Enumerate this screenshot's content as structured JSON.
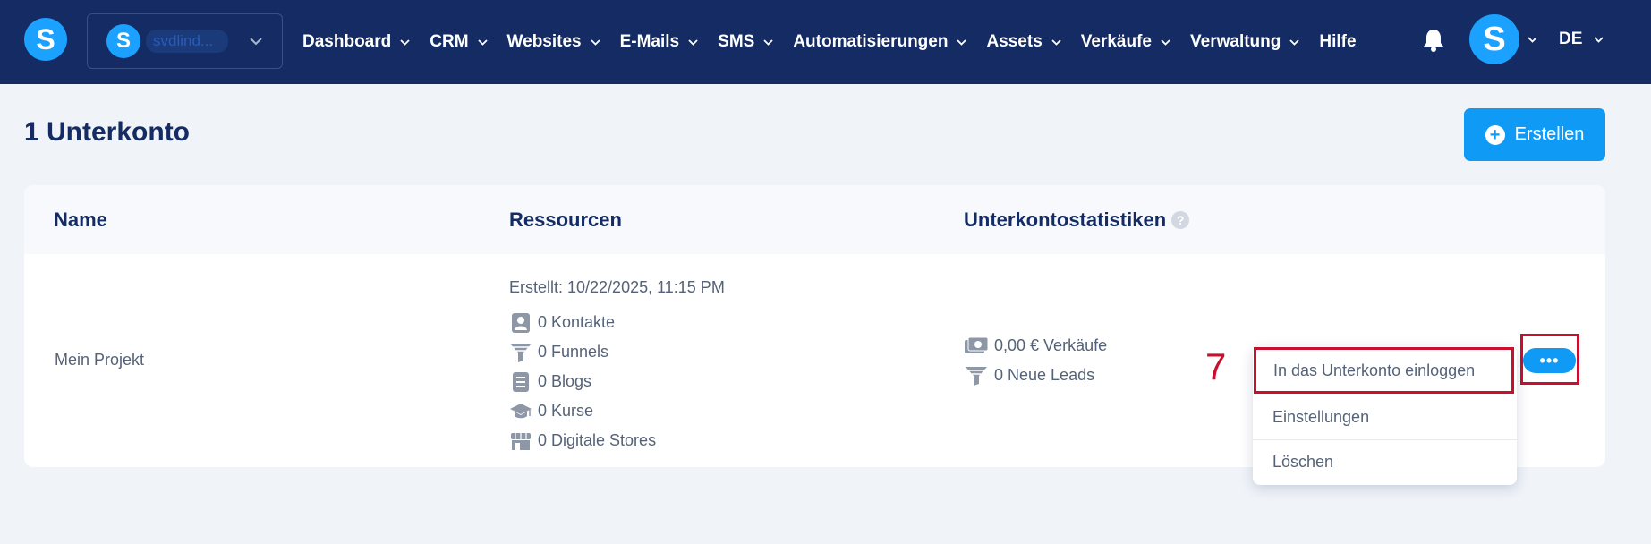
{
  "header": {
    "logo_letter": "S",
    "account": {
      "avatar_letter": "S",
      "name": "svdlind..."
    },
    "nav": [
      {
        "label": "Dashboard"
      },
      {
        "label": "CRM"
      },
      {
        "label": "Websites"
      },
      {
        "label": "E-Mails"
      },
      {
        "label": "SMS"
      },
      {
        "label": "Automatisierungen"
      },
      {
        "label": "Assets"
      },
      {
        "label": "Verkäufe"
      },
      {
        "label": "Verwaltung"
      }
    ],
    "help_label": "Hilfe",
    "user_avatar_letter": "S",
    "language": "DE"
  },
  "page": {
    "title": "1 Unterkonto",
    "create_button": "Erstellen",
    "plus_symbol": "+"
  },
  "table": {
    "columns": [
      "Name",
      "Ressourcen",
      "Unterkontostatistiken"
    ],
    "help_symbol": "?",
    "row": {
      "name": "Mein Projekt",
      "created": "Erstellt: 10/22/2025, 11:15 PM",
      "resources": [
        {
          "icon": "contacts-icon",
          "label": "0 Kontakte"
        },
        {
          "icon": "funnel-icon",
          "label": "0 Funnels"
        },
        {
          "icon": "blog-icon",
          "label": "0 Blogs"
        },
        {
          "icon": "graduation-cap-icon",
          "label": "0 Kurse"
        },
        {
          "icon": "store-icon",
          "label": "0 Digitale Stores"
        }
      ],
      "stats": [
        {
          "icon": "money-icon",
          "label": "0,00 € Verkäufe"
        },
        {
          "icon": "funnel-icon",
          "label": "0 Neue Leads"
        }
      ],
      "more_label": "•••"
    }
  },
  "dropdown": {
    "items": [
      {
        "label": "In das Unterkonto einloggen"
      },
      {
        "label": "Einstellungen"
      },
      {
        "label": "Löschen"
      }
    ]
  },
  "annotation": {
    "step_number": "7",
    "highlight_color": "#c8102e"
  },
  "colors": {
    "nav_bg": "#142c63",
    "accent": "#0f9bf5",
    "page_bg": "#f0f3f8"
  }
}
